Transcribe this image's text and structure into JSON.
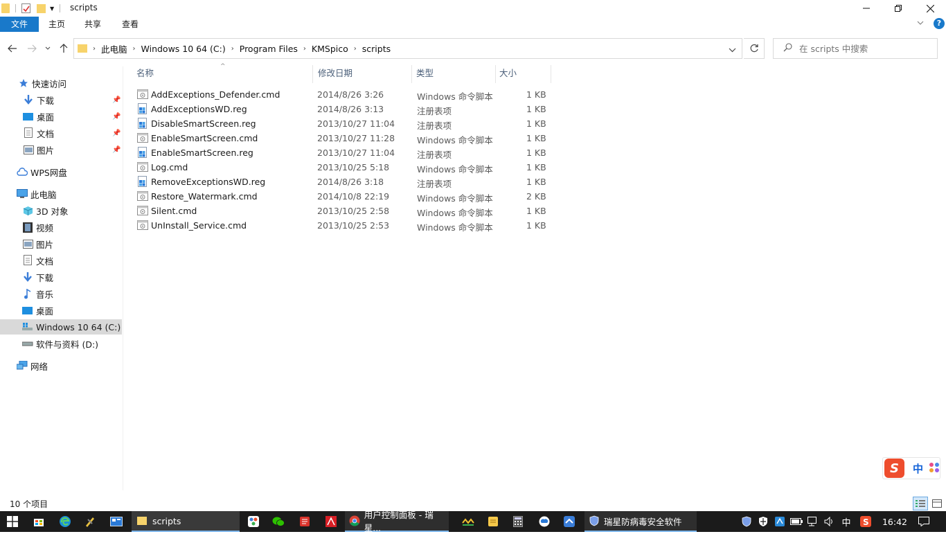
{
  "window": {
    "title": "scripts",
    "ribbon_tabs": [
      "文件",
      "主页",
      "共享",
      "查看"
    ]
  },
  "address": {
    "crumbs": [
      "此电脑",
      "Windows 10 64 (C:)",
      "Program Files",
      "KMSpico",
      "scripts"
    ],
    "search_placeholder": "在 scripts 中搜索"
  },
  "sidebar": {
    "quick_access": "快速访问",
    "quick_items": [
      "下载",
      "桌面",
      "文档",
      "图片"
    ],
    "wps": "WPS网盘",
    "this_pc": "此电脑",
    "pc_items": [
      "3D 对象",
      "视频",
      "图片",
      "文档",
      "下载",
      "音乐",
      "桌面",
      "Windows 10 64 (C:)",
      "软件与资料 (D:)"
    ],
    "network": "网络"
  },
  "columns": {
    "name": "名称",
    "date": "修改日期",
    "type": "类型",
    "size": "大小"
  },
  "files": [
    {
      "name": "AddExceptions_Defender.cmd",
      "date": "2014/8/26 3:26",
      "type": "Windows 命令脚本",
      "size": "1 KB",
      "icon": "cmd"
    },
    {
      "name": "AddExceptionsWD.reg",
      "date": "2014/8/26 3:13",
      "type": "注册表项",
      "size": "1 KB",
      "icon": "reg"
    },
    {
      "name": "DisableSmartScreen.reg",
      "date": "2013/10/27 11:04",
      "type": "注册表项",
      "size": "1 KB",
      "icon": "reg"
    },
    {
      "name": "EnableSmartScreen.cmd",
      "date": "2013/10/27 11:28",
      "type": "Windows 命令脚本",
      "size": "1 KB",
      "icon": "cmd"
    },
    {
      "name": "EnableSmartScreen.reg",
      "date": "2013/10/27 11:04",
      "type": "注册表项",
      "size": "1 KB",
      "icon": "reg"
    },
    {
      "name": "Log.cmd",
      "date": "2013/10/25 5:18",
      "type": "Windows 命令脚本",
      "size": "1 KB",
      "icon": "cmd"
    },
    {
      "name": "RemoveExceptionsWD.reg",
      "date": "2014/8/26 3:18",
      "type": "注册表项",
      "size": "1 KB",
      "icon": "reg"
    },
    {
      "name": "Restore_Watermark.cmd",
      "date": "2014/10/8 22:19",
      "type": "Windows 命令脚本",
      "size": "2 KB",
      "icon": "cmd"
    },
    {
      "name": "Silent.cmd",
      "date": "2013/10/25 2:58",
      "type": "Windows 命令脚本",
      "size": "1 KB",
      "icon": "cmd"
    },
    {
      "name": "UnInstall_Service.cmd",
      "date": "2013/10/25 2:53",
      "type": "Windows 命令脚本",
      "size": "1 KB",
      "icon": "cmd"
    }
  ],
  "status": {
    "item_count": "10 个项目"
  },
  "taskbar": {
    "explorer_label": "scripts",
    "chrome_label": "用户控制面板 - 瑞星...",
    "rising_label": "瑞星防病毒安全软件",
    "ime": "中",
    "clock": "16:42"
  },
  "ime_bar": {
    "mode": "中"
  },
  "colors": {
    "file_tab": "#1979ca",
    "selection": "#d9d9d9",
    "taskbar": "#1b1b1b",
    "header_text": "#4c607a"
  }
}
